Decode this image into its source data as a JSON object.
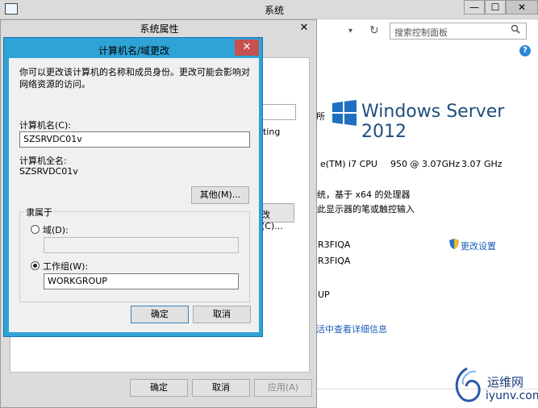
{
  "system_window": {
    "title": "系统",
    "min_glyph": "—",
    "max_glyph": "☐",
    "close_glyph": "✕",
    "nav_dropdown_glyph": "▾",
    "refresh_glyph": "↻",
    "search_placeholder": "搜索控制面板",
    "help_glyph": "?",
    "edition_prefix": "所",
    "edition_text": "Windows Server 2012",
    "cpu_model": "e(TM) i7 CPU",
    "cpu_speed_a": "950  @ 3.07GHz",
    "cpu_speed_b": "3.07 GHz",
    "system_type": "统，基于 x64 的处理器",
    "pen_touch": "此显示器的笔或触控输入",
    "code_line_1": "R3FIQA",
    "code_line_2": "R3FIQA",
    "change_settings": "更改设置",
    "up_text": "UP",
    "online_info": "活中查看详细信息",
    "watermark_cn": "运维网",
    "watermark_url": "iyunv.com"
  },
  "props_dialog": {
    "title": "系统属性",
    "close_glyph": "✕",
    "frag_text": "nting",
    "frag_button": "改(C)...",
    "ok": "确定",
    "cancel": "取消",
    "apply": "应用(A)"
  },
  "name_dialog": {
    "title": "计算机名/域更改",
    "close_glyph": "✕",
    "intro": "你可以更改该计算机的名称和成员身份。更改可能会影响对网络资源的访问。",
    "computer_name_label": "计算机名(C):",
    "computer_name_value": "SZSRVDC01v",
    "full_name_label": "计算机全名:",
    "full_name_value": "SZSRVDC01v",
    "more_button": "其他(M)...",
    "member_of_label": "隶属于",
    "domain_label": "域(D):",
    "domain_value": "",
    "workgroup_label": "工作组(W):",
    "workgroup_value": "WORKGROUP",
    "selected": "workgroup",
    "ok": "确定",
    "cancel": "取消"
  },
  "colors": {
    "dialog_accent": "#2fa3d6",
    "close_red": "#c75050",
    "link_blue": "#1a5dbb",
    "brand_blue": "#1f4e7d"
  }
}
